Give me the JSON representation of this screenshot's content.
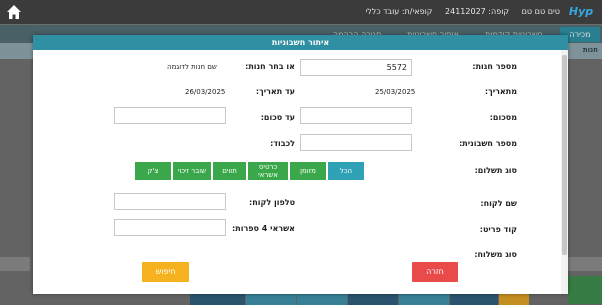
{
  "topbar": {
    "logo": "Hyp",
    "items": [
      "טים טם טם",
      "קופה: 24112027",
      "קופאי/ת: עובד כללי"
    ]
  },
  "bg": {
    "tabs": [
      "מכירה",
      "חשבוניות קודמות",
      "איתור חשבוניות",
      "סגירה הבהמה"
    ],
    "strip_label": "חנות"
  },
  "modal": {
    "title": "איתור חשבוניות",
    "store_number_label": "מספר חנות:",
    "store_number_value": "5572",
    "or_choose_store_label": "או בחר חנות:",
    "default_store_text": "שם חנות לדוגמה",
    "from_date_label": "מתאריך:",
    "from_date_value": "25/03/2025",
    "to_date_label": "עד תאריך:",
    "to_date_value": "26/03/2025",
    "from_amount_label": "מסכום:",
    "to_amount_label": "עד סכום:",
    "invoice_number_label": "מספר חשבונית:",
    "for_label": "לכבוד:",
    "payment_type_label": "סוג תשלום:",
    "payment_buttons": [
      "הכל",
      "מזומן",
      "כרטיס אשראי",
      "תווים",
      "שובר זיכוי",
      "צ'ק"
    ],
    "customer_name_label": "שם לקוח:",
    "customer_phone_label": "טלפון לקוח:",
    "price_code_label": "קוד פריט:",
    "credit_4_label": "אשראי 4 ספרות:",
    "shipping_type_label": "סוג משלוח:",
    "return_button": "חזרה",
    "search_button": "חיפוש"
  }
}
